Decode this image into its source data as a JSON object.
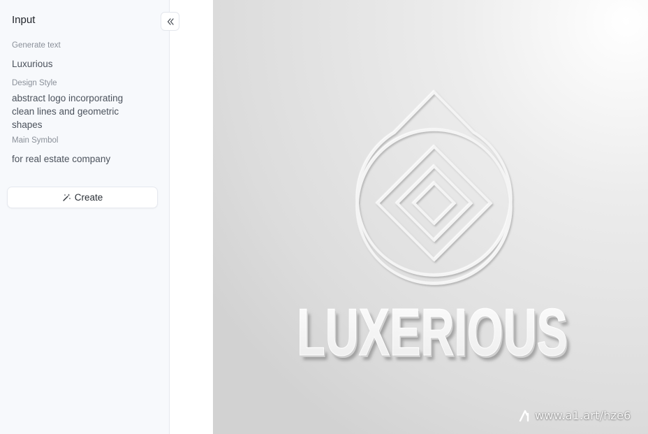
{
  "sidebar": {
    "title": "Input",
    "fields": [
      {
        "label": "Generate text",
        "value": "Luxurious"
      },
      {
        "label": "Design Style",
        "value": "abstract logo incorporating clean lines and geometric shapes"
      },
      {
        "label": "Main Symbol",
        "value": "for real estate company"
      }
    ],
    "create_label": "Create"
  },
  "result": {
    "logo_text": "LUXERIOUS",
    "watermark": "www.a1.art/hze6"
  },
  "icons": {
    "collapse": "chevrons-left-icon",
    "create": "magic-wand-icon",
    "watermark": "a1-logo-icon"
  }
}
